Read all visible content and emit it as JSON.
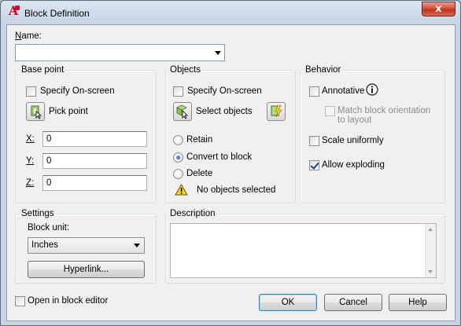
{
  "window": {
    "title": "Block Definition",
    "close_glyph": "x"
  },
  "name": {
    "label": "Name:",
    "value": ""
  },
  "base_point": {
    "title": "Base point",
    "specify_label": "Specify On-screen",
    "specify_checked": false,
    "pick_label": "Pick point",
    "x_label": "X:",
    "x_value": "0",
    "y_label": "Y:",
    "y_value": "0",
    "z_label": "Z:",
    "z_value": "0"
  },
  "objects": {
    "title": "Objects",
    "specify_label": "Specify On-screen",
    "specify_checked": false,
    "select_label": "Select objects",
    "radio_retain": "Retain",
    "radio_convert": "Convert to block",
    "radio_delete": "Delete",
    "selected_radio": "Convert to block",
    "status_text": "No objects selected"
  },
  "behavior": {
    "title": "Behavior",
    "annotative_label": "Annotative",
    "annotative_checked": false,
    "match_label_line1": "Match block orientation",
    "match_label_line2": "to layout",
    "match_checked": false,
    "scale_label": "Scale uniformly",
    "scale_checked": false,
    "explode_label": "Allow exploding",
    "explode_checked": true
  },
  "settings": {
    "title": "Settings",
    "unit_label": "Block unit:",
    "unit_value": "Inches",
    "hyperlink_label": "Hyperlink..."
  },
  "description": {
    "title": "Description",
    "value": ""
  },
  "footer": {
    "open_editor_label": "Open in block editor",
    "open_editor_checked": false,
    "ok_label": "OK",
    "cancel_label": "Cancel",
    "help_label": "Help"
  },
  "colors": {
    "titlebar": "#c7d4e4",
    "dialog_bg": "#f0f0f0",
    "close_button": "#c0321c",
    "default_button_border": "#3c7fb1"
  },
  "icons": {
    "app": "autocad-icon",
    "pick_point": "pick-point-icon",
    "select_objects": "select-objects-icon",
    "quick_select": "quick-select-icon",
    "info": "info-icon",
    "warning": "warning-icon"
  }
}
